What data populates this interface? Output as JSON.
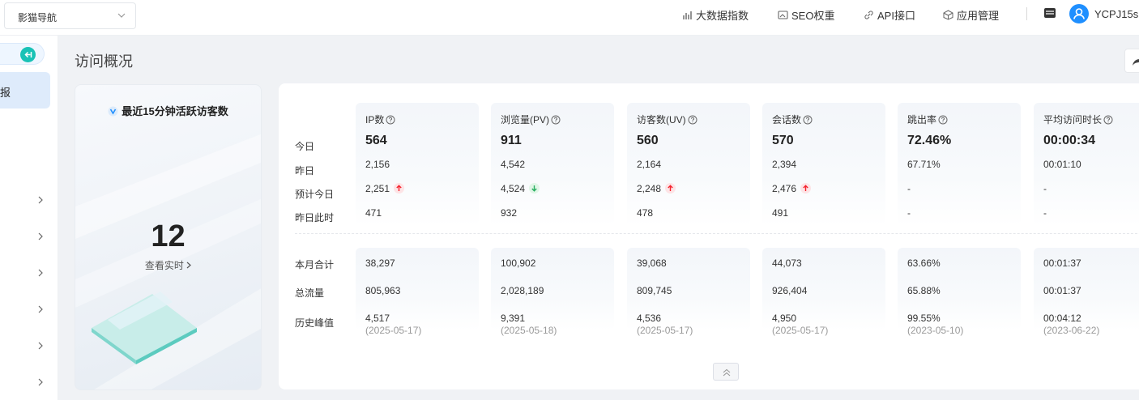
{
  "header": {
    "site_select": "影猫导航",
    "nav": [
      {
        "label": "大数据指数",
        "icon": "chart-icon"
      },
      {
        "label": "SEO权重",
        "icon": "image-icon"
      },
      {
        "label": "API接口",
        "icon": "link-icon"
      },
      {
        "label": "应用管理",
        "icon": "cube-icon"
      }
    ],
    "username": "YCPJ15s"
  },
  "sidebar": {
    "active_label": "报"
  },
  "page": {
    "title": "访问概况"
  },
  "live": {
    "title": "最近15分钟活跃访客数",
    "count": "12",
    "link": "查看实时"
  },
  "stats": {
    "row_labels_top": [
      "今日",
      "昨日",
      "预计今日",
      "昨日此时"
    ],
    "row_labels_bottom": [
      "本月合计",
      "总流量",
      "历史峰值"
    ],
    "columns": [
      {
        "head": "IP数",
        "today": "564",
        "yesterday": "2,156",
        "forecast": "2,251",
        "trend": "up",
        "same_time": "471",
        "month": "38,297",
        "total": "805,963",
        "peak": "4,517",
        "peak_date": "(2025-05-17)"
      },
      {
        "head": "浏览量(PV)",
        "today": "911",
        "yesterday": "4,542",
        "forecast": "4,524",
        "trend": "down",
        "same_time": "932",
        "month": "100,902",
        "total": "2,028,189",
        "peak": "9,391",
        "peak_date": "(2025-05-18)"
      },
      {
        "head": "访客数(UV)",
        "today": "560",
        "yesterday": "2,164",
        "forecast": "2,248",
        "trend": "up",
        "same_time": "478",
        "month": "39,068",
        "total": "809,745",
        "peak": "4,536",
        "peak_date": "(2025-05-17)"
      },
      {
        "head": "会话数",
        "today": "570",
        "yesterday": "2,394",
        "forecast": "2,476",
        "trend": "up",
        "same_time": "491",
        "month": "44,073",
        "total": "926,404",
        "peak": "4,950",
        "peak_date": "(2025-05-17)"
      },
      {
        "head": "跳出率",
        "today": "72.46%",
        "yesterday": "67.71%",
        "forecast": "-",
        "trend": "",
        "same_time": "-",
        "month": "63.66%",
        "total": "65.88%",
        "peak": "99.55%",
        "peak_date": "(2023-05-10)"
      },
      {
        "head": "平均访问时长",
        "today": "00:00:34",
        "yesterday": "00:01:10",
        "forecast": "-",
        "trend": "",
        "same_time": "-",
        "month": "00:01:37",
        "total": "00:01:37",
        "peak": "00:04:12",
        "peak_date": "(2023-06-22)"
      }
    ]
  },
  "colors": {
    "accent": "#1f8fff",
    "teal": "#19c2b6",
    "up": "#f5222d",
    "down": "#27ae60"
  }
}
